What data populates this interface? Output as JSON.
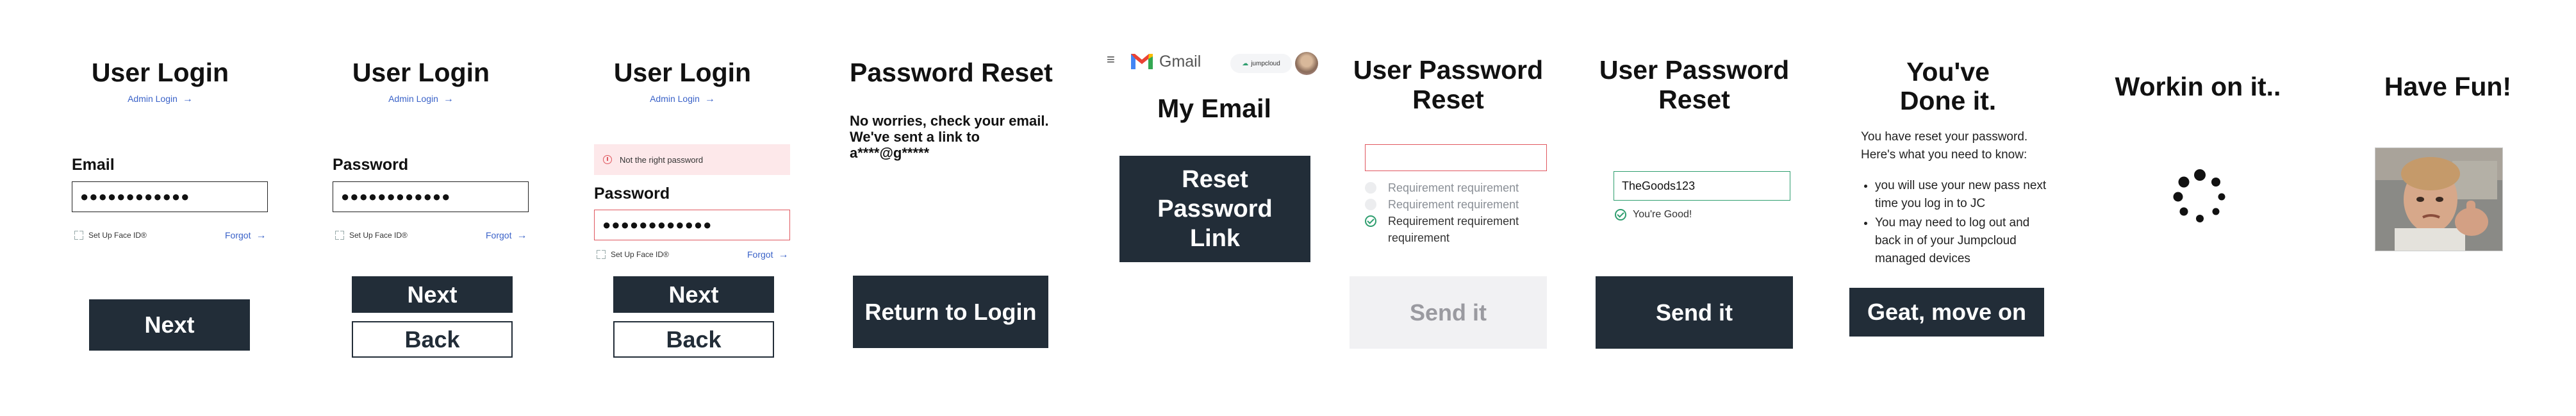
{
  "screens": {
    "login1": {
      "title": "User Login",
      "admin_link": "Admin Login",
      "field_label": "Email",
      "field_value": "●●●●●●●●●●●●",
      "faceid": "Set Up Face ID®",
      "forgot": "Forgot",
      "next": "Next"
    },
    "login2": {
      "title": "User Login",
      "admin_link": "Admin Login",
      "field_label": "Password",
      "field_value": "●●●●●●●●●●●●",
      "faceid": "Set Up Face ID®",
      "forgot": "Forgot",
      "next": "Next",
      "back": "Back"
    },
    "login3": {
      "title": "User Login",
      "admin_link": "Admin Login",
      "error": "Not the right password",
      "field_label": "Password",
      "field_value": "●●●●●●●●●●●●",
      "faceid": "Set Up Face ID®",
      "forgot": "Forgot",
      "next": "Next",
      "back": "Back"
    },
    "reset_sent": {
      "title": "Password Reset",
      "body": "No worries, check your email. We've sent a link to a****@g*****",
      "button": "Return to Login"
    },
    "email": {
      "gmail": "Gmail",
      "jumpcloud": "jumpcloud",
      "title": "My Email",
      "button": "Reset Password Link"
    },
    "reset_form": {
      "title": "User Password Reset",
      "req1": "Requirement requirement",
      "req2": "Requirement requirement",
      "req3": "Requirement requirement requirement",
      "button": "Send it"
    },
    "reset_ok": {
      "title": "User Password Reset",
      "field_value": "TheGoods123",
      "ok": "You're Good!",
      "button": "Send it"
    },
    "done": {
      "title": "You've Done it.",
      "intro": "You have reset your password. Here's what you need to know:",
      "bullets": [
        "you will use your new pass next time you log in to JC",
        "You may need to log out and back in of your Jumpcloud managed devices"
      ],
      "button": "Geat, move on"
    },
    "loading": {
      "title": "Workin on it.."
    },
    "fun": {
      "title": "Have Fun!"
    }
  },
  "colors": {
    "dark_button": "#222d38",
    "link": "#3a62c8",
    "error": "#e0575f",
    "success": "#2f9e6f"
  }
}
